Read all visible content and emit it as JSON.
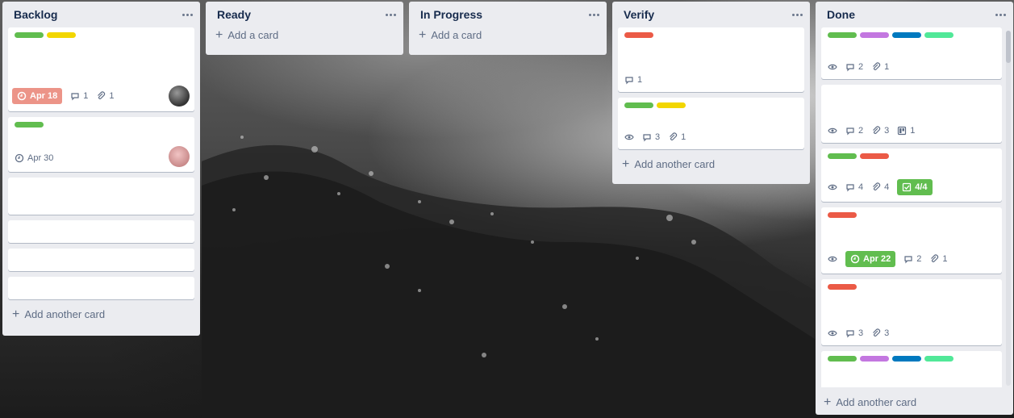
{
  "colors": {
    "green": "#61bd4f",
    "yellow": "#f2d600",
    "red": "#eb5a46",
    "purple": "#c377e0",
    "blue": "#0079bf",
    "mint": "#51e898",
    "overdue": "#ec9488",
    "complete": "#61bd4f"
  },
  "lists": [
    {
      "title": "Backlog",
      "add_label": "Add another card",
      "cards": [
        {
          "labels": [
            "green",
            "yellow"
          ],
          "due": "Apr 18",
          "comments": "1",
          "attachments": "1",
          "avatar": "dark"
        },
        {
          "labels": [
            "green"
          ],
          "due": "Apr 30",
          "avatar": "pink"
        },
        {},
        {},
        {},
        {}
      ]
    },
    {
      "title": "Ready",
      "add_label": "Add a card",
      "cards": []
    },
    {
      "title": "In Progress",
      "add_label": "Add a card",
      "cards": []
    },
    {
      "title": "Verify",
      "add_label": "Add another card",
      "cards": [
        {
          "labels": [
            "red"
          ],
          "comments": "1"
        },
        {
          "labels": [
            "green",
            "yellow"
          ],
          "watch": true,
          "comments": "3",
          "attachments": "1"
        }
      ]
    },
    {
      "title": "Done",
      "add_label": "Add another card",
      "cards": [
        {
          "labels": [
            "green",
            "purple",
            "blue",
            "mint"
          ],
          "watch": true,
          "comments": "2",
          "attachments": "1"
        },
        {
          "labels": [],
          "watch": true,
          "comments": "2",
          "attachments": "3",
          "trello": "1"
        },
        {
          "labels": [
            "green",
            "red"
          ],
          "watch": true,
          "comments": "4",
          "attachments": "4",
          "checklist": "4/4"
        },
        {
          "labels": [
            "red"
          ],
          "watch": true,
          "due": "Apr 22",
          "comments": "2",
          "attachments": "1"
        },
        {
          "labels": [
            "red"
          ],
          "watch": true,
          "comments": "3",
          "attachments": "3"
        },
        {
          "labels": [
            "green",
            "purple",
            "blue",
            "mint"
          ]
        }
      ]
    }
  ]
}
